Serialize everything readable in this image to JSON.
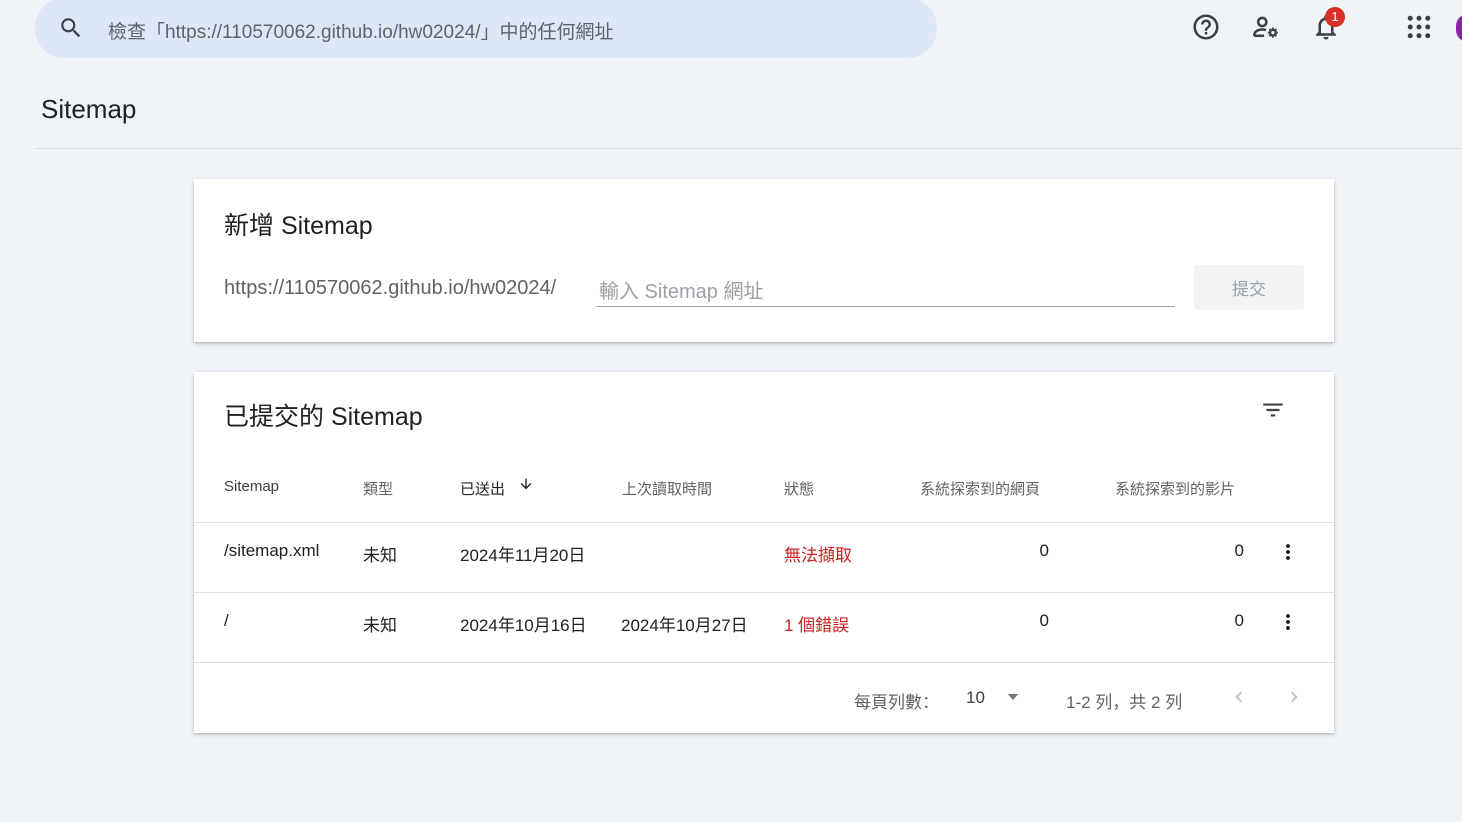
{
  "header": {
    "search_placeholder": "檢查「https://110570062.github.io/hw02024/」中的任何網址",
    "notification_count": "1",
    "icons": [
      "search-icon",
      "help-icon",
      "manage-users-icon",
      "bell-icon",
      "apps-grid-icon"
    ]
  },
  "page_title": "Sitemap",
  "add_card": {
    "title": "新增 Sitemap",
    "url_prefix": "https://110570062.github.io/hw02024/",
    "input_placeholder": "輸入 Sitemap 網址",
    "input_value": "",
    "submit_label": "提交"
  },
  "submitted_card": {
    "title": "已提交的 Sitemap",
    "columns": [
      "Sitemap",
      "類型",
      "已送出",
      "上次讀取時間",
      "狀態",
      "系統探索到的網頁",
      "系統探索到的影片"
    ],
    "rows": [
      {
        "sitemap": "/sitemap.xml",
        "type": "未知",
        "submitted": "2024年11月20日",
        "last_read": "",
        "status": "無法擷取",
        "pages": "0",
        "videos": "0"
      },
      {
        "sitemap": "/",
        "type": "未知",
        "submitted": "2024年10月16日",
        "last_read": "2024年10月27日",
        "status": "1 個錯誤",
        "pages": "0",
        "videos": "0"
      }
    ],
    "footer": {
      "rows_per_page_label": "每頁列數：",
      "rows_per_page_value": "10",
      "range_text": "1-2 列，共 2 列"
    }
  },
  "colors": {
    "background": "#f0f4f9",
    "search_bg": "#dde7f8",
    "error_red": "#c5221f",
    "badge_red": "#d93025",
    "avatar_purple": "#8e24aa"
  }
}
